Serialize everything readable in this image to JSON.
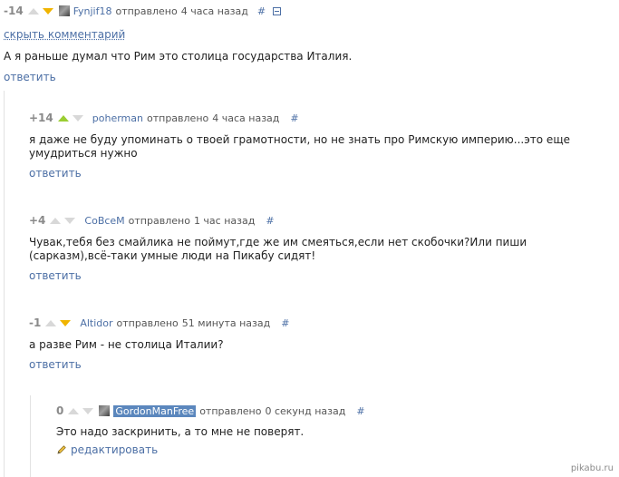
{
  "comments": [
    {
      "rating": "-14",
      "author": "Fynjif18",
      "sent_label": "отправлено",
      "time": "4 часа назад",
      "hash": "#",
      "hide_label": "скрыть комментарий",
      "text": "А я раньше думал что Рим это столица государства Италия.",
      "reply_label": "ответить",
      "vote": "down"
    },
    {
      "rating": "+14",
      "author": "poherman",
      "sent_label": "отправлено",
      "time": "4 часа назад",
      "hash": "#",
      "text": "я даже не буду упоминать о твоей грамотности, но не знать про Римскую империю...это еще умудриться нужно",
      "reply_label": "ответить",
      "vote": "up"
    },
    {
      "rating": "+4",
      "author": "CoBceM",
      "sent_label": "отправлено",
      "time": "1 час назад",
      "hash": "#",
      "text": "Чувак,тебя без смайлика не поймут,где же им смеяться,если нет скобочки?Или пиши (сарказм),всё-таки умные люди на Пикабу сидят!",
      "reply_label": "ответить",
      "vote": "none"
    },
    {
      "rating": "-1",
      "author": "Altidor",
      "sent_label": "отправлено",
      "time": "51 минута назад",
      "hash": "#",
      "text": "а разве Рим - не столица Италии?",
      "reply_label": "ответить",
      "vote": "down"
    },
    {
      "rating": "0",
      "author": "GordonManFree",
      "sent_label": "отправлено",
      "time": "0 секунд назад",
      "hash": "#",
      "text": "Это надо заскринить, а то мне не поверят.",
      "edit_label": "редактировать",
      "vote": "none"
    }
  ],
  "watermark": "pikabu.ru",
  "colors": {
    "link": "#4c6fa5",
    "upvote_active": "#9acd32",
    "downvote_active": "#f0b400",
    "arrow_inactive": "#d8d8d8",
    "rating": "#8a8a8a"
  }
}
